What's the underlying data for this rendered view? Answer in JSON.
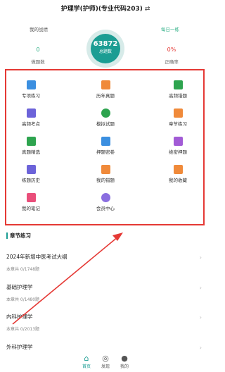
{
  "header": {
    "title": "护理学(护师)(专业代码203)",
    "swap_icon": "⇄"
  },
  "stats": {
    "my_record": "我的战绩",
    "daily_practice": "每日一练",
    "done_count": "0",
    "done_label": "做题数",
    "total_count": "63872",
    "total_label": "总题数",
    "accuracy": "0%",
    "accuracy_label": "正确率"
  },
  "grid": [
    {
      "label": "专项练习",
      "icon": "book-icon",
      "color": "#3b8fe0"
    },
    {
      "label": "历年真题",
      "icon": "list-doc-icon",
      "color": "#f08a3a"
    },
    {
      "label": "高频错题",
      "icon": "error-book-icon",
      "color": "#2ea44f"
    },
    {
      "label": "高频考点",
      "icon": "doc-chart-icon",
      "color": "#6c63d9"
    },
    {
      "label": "模拟试题",
      "icon": "target-icon",
      "color": "#2ea44f"
    },
    {
      "label": "章节练习",
      "icon": "pencil-doc-icon",
      "color": "#f08a3a"
    },
    {
      "label": "真题精选",
      "icon": "open-book-icon",
      "color": "#2ea44f"
    },
    {
      "label": "押题密卷",
      "icon": "edit-doc-icon",
      "color": "#3b8fe0"
    },
    {
      "label": "绝密押题",
      "icon": "secret-book-icon",
      "color": "#a25bd6"
    },
    {
      "label": "练题历史",
      "icon": "history-icon",
      "color": "#6c63d9"
    },
    {
      "label": "我的错题",
      "icon": "wrong-question-icon",
      "color": "#f08a3a"
    },
    {
      "label": "我的收藏",
      "icon": "favorite-icon",
      "color": "#f08a3a"
    },
    {
      "label": "我的笔记",
      "icon": "calendar-note-icon",
      "color": "#e94e7a"
    },
    {
      "label": "会员中心",
      "icon": "vip-icon",
      "color": "#8a6ee0"
    }
  ],
  "section": {
    "title": "章节练习"
  },
  "chapters": [
    {
      "title": "2024年新增中医考试大纲",
      "progress": "本章共 0/1748题"
    },
    {
      "title": "基础护理学",
      "progress": "本章共 0/1480题"
    },
    {
      "title": "内科护理学",
      "progress": "本章共 0/2013题"
    },
    {
      "title": "外科护理学",
      "progress": ""
    }
  ],
  "tabs": [
    {
      "label": "首页",
      "icon": "home-icon",
      "glyph": "⌂"
    },
    {
      "label": "发现",
      "icon": "compass-icon",
      "glyph": "◎"
    },
    {
      "label": "我的",
      "icon": "user-icon",
      "glyph": "●"
    }
  ],
  "colors": {
    "accent": "#1b9d93",
    "highlight_border": "#e53935"
  }
}
